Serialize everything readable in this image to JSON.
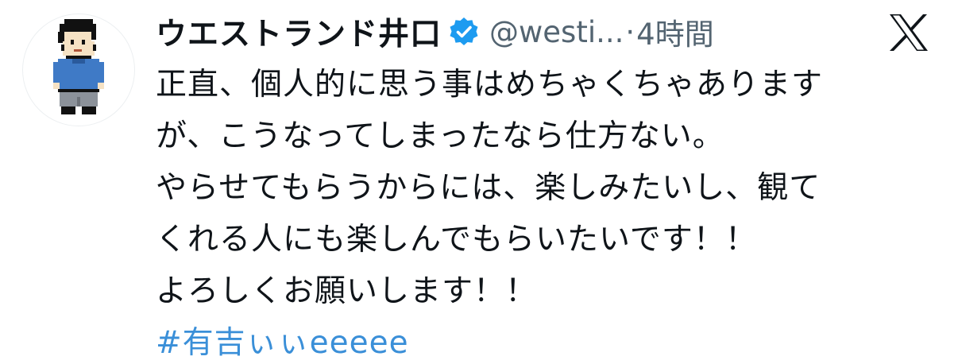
{
  "author": {
    "display_name": "ウエストランド井口",
    "handle": "@westi...",
    "separator": "·",
    "timestamp": "4時間",
    "verified": true
  },
  "tweet": {
    "lines": [
      "正直、個人的に思う事はめちゃくちゃあります",
      "が、こうなってしまったなら仕方ない。",
      "やらせてもらうからには、楽しみたいし、観て",
      "くれる人にも楽しんでもらいたいです！！",
      "よろしくお願いします！！"
    ],
    "hashtag": "#有吉ぃぃeeeee"
  },
  "icons": {
    "avatar": "pixel-art-avatar",
    "verified": "verified-badge-icon",
    "platform": "x-logo-icon"
  },
  "colors": {
    "verified": "#1d9bf0",
    "hashtag": "#3a8fd8",
    "secondary_text": "#536471"
  }
}
